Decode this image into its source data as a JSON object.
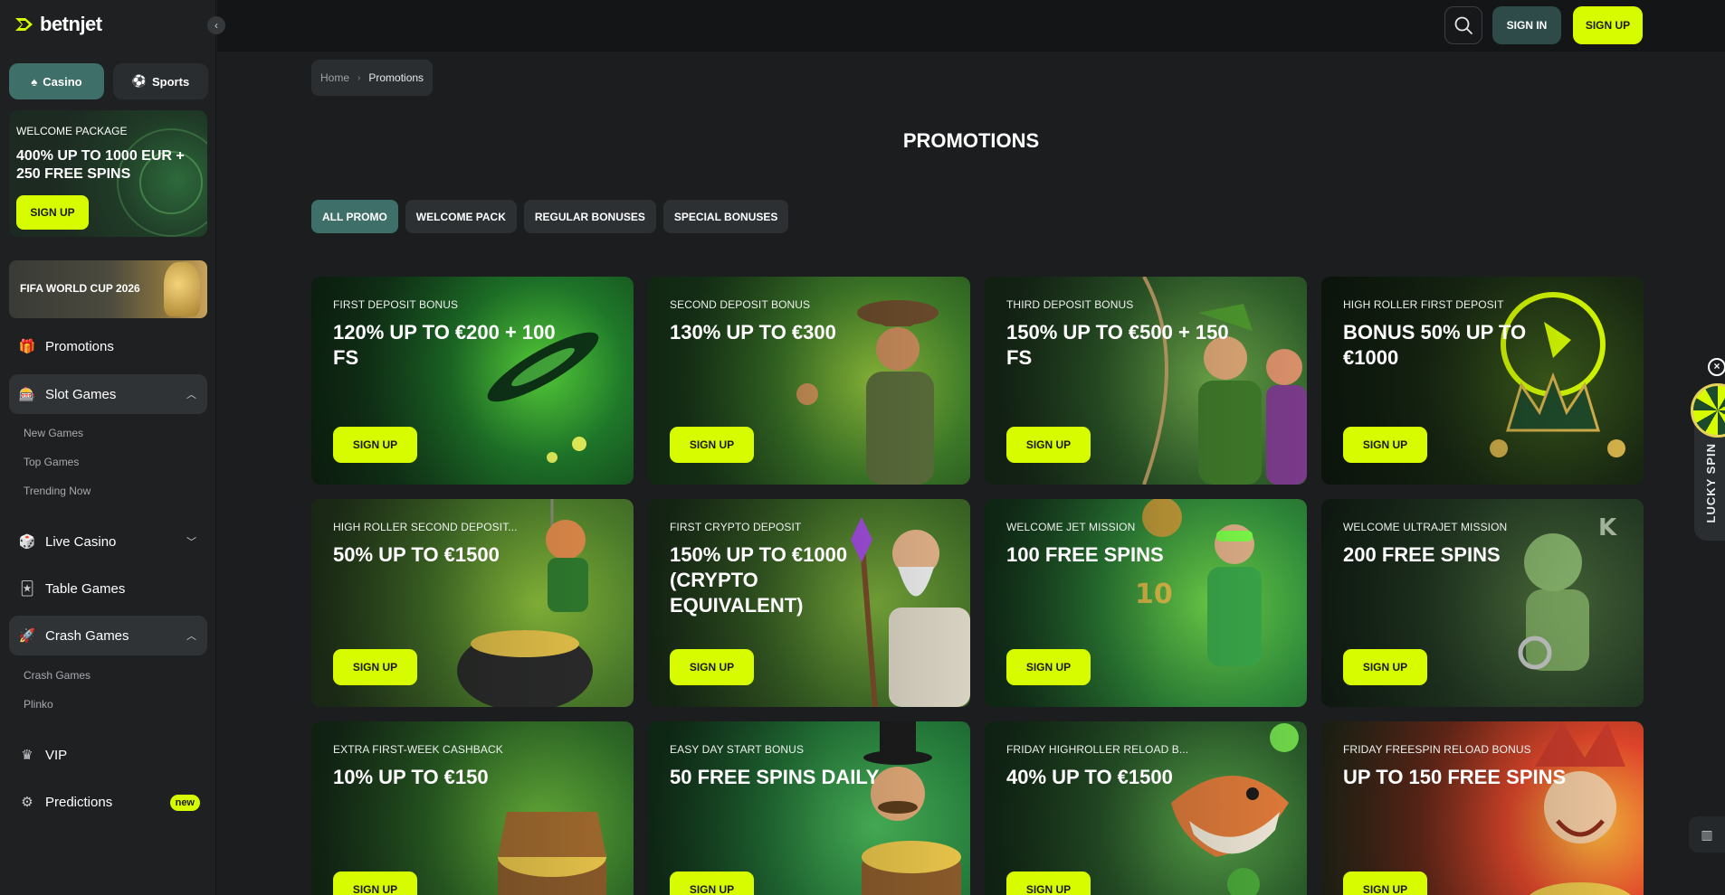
{
  "brand": {
    "logo_text": "betnjet",
    "accent": "#d7fc00",
    "teal": "#3f6f69"
  },
  "sidebar": {
    "mode_tabs": [
      {
        "label": "Casino",
        "icon": "spade-icon",
        "active": true
      },
      {
        "label": "Sports",
        "icon": "soccer-ball-icon",
        "active": false
      }
    ],
    "welcome": {
      "label": "WELCOME PACKAGE",
      "title": "400% UP TO 1000 EUR + 250 FREE SPINS",
      "button": "SIGN UP"
    },
    "fifa": {
      "title": "FIFA WORLD CUP 2026"
    },
    "nav": [
      {
        "label": "Promotions",
        "icon": "gift-icon"
      },
      {
        "label": "Slot Games",
        "icon": "slot-machine-icon",
        "expanded": true,
        "children": [
          "New Games",
          "Top Games",
          "Trending Now"
        ]
      },
      {
        "label": "Live Casino",
        "icon": "dice-icon",
        "expanded": false
      },
      {
        "label": "Table Games",
        "icon": "cards-icon"
      },
      {
        "label": "Crash Games",
        "icon": "rocket-icon",
        "expanded": true,
        "children": [
          "Crash Games",
          "Plinko"
        ]
      },
      {
        "label": "VIP",
        "icon": "crown-icon"
      },
      {
        "label": "Predictions",
        "icon": "gear-icon",
        "badge": "new"
      }
    ]
  },
  "topbar": {
    "search_icon": "search-icon",
    "signin": "SIGN IN",
    "signup": "SIGN UP"
  },
  "breadcrumb": {
    "home": "Home",
    "current": "Promotions"
  },
  "page_title": "PROMOTIONS",
  "filters": [
    {
      "label": "ALL PROMO",
      "active": true
    },
    {
      "label": "WELCOME PACK",
      "active": false
    },
    {
      "label": "REGULAR BONUSES",
      "active": false
    },
    {
      "label": "SPECIAL BONUSES",
      "active": false
    }
  ],
  "promos": [
    {
      "label": "FIRST DEPOSIT BONUS",
      "title": "120% UP TO €200 + 100 FS",
      "button": "SIGN UP",
      "theme": "rocket"
    },
    {
      "label": "SECOND DEPOSIT BONUS",
      "title": "130% UP TO €300",
      "button": "SIGN UP",
      "theme": "explorer"
    },
    {
      "label": "THIRD DEPOSIT BONUS",
      "title": "150% UP TO €500 + 150 FS",
      "button": "SIGN UP",
      "theme": "archer"
    },
    {
      "label": "HIGH ROLLER FIRST DEPOSIT",
      "title": "BONUS 50% UP TO €1000",
      "button": "SIGN UP",
      "theme": "crown"
    },
    {
      "label": "HIGH ROLLER SECOND DEPOSIT...",
      "title": "50% UP TO €1500",
      "button": "SIGN UP",
      "theme": "leprechaun"
    },
    {
      "label": "FIRST CRYPTO DEPOSIT",
      "title": "150% UP TO €1000 (CRYPTO EQUIVALENT)",
      "button": "SIGN UP",
      "theme": "wizard"
    },
    {
      "label": "WELCOME JET MISSION",
      "title": "100 FREE SPINS",
      "button": "SIGN UP",
      "theme": "hero"
    },
    {
      "label": "WELCOME ULTRAJET MISSION",
      "title": "200 FREE SPINS",
      "button": "SIGN UP",
      "theme": "astronaut"
    },
    {
      "label": "EXTRA FIRST-WEEK CASHBACK",
      "title": "10% UP TO €150",
      "button": "SIGN UP",
      "theme": "chest"
    },
    {
      "label": "EASY DAY START BONUS",
      "title": "50 FREE SPINS DAILY",
      "button": "SIGN UP",
      "theme": "tycoon"
    },
    {
      "label": "FRIDAY HIGHROLLER RELOAD B...",
      "title": "40% UP TO €1500",
      "button": "SIGN UP",
      "theme": "shark"
    },
    {
      "label": "FRIDAY FREESPIN RELOAD BONUS",
      "title": "UP TO 150 FREE SPINS",
      "button": "SIGN UP",
      "theme": "jester"
    }
  ],
  "lucky_spin": {
    "label": "LUCKY SPIN"
  }
}
